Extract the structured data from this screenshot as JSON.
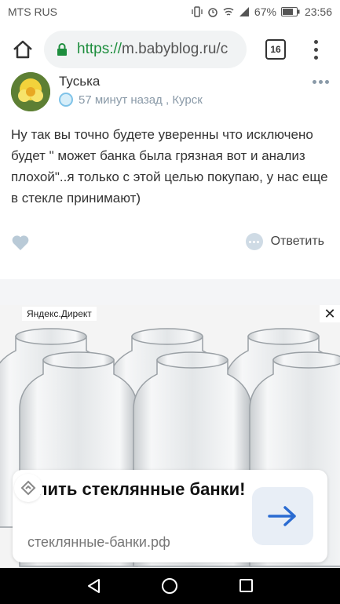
{
  "status_bar": {
    "carrier": "MTS RUS",
    "battery": "67%",
    "time": "23:56"
  },
  "browser": {
    "url_scheme": "https://",
    "url_rest": "m.babyblog.ru/c",
    "tab_count": "16"
  },
  "post": {
    "author": "Туська",
    "time_ago": "57 минут назад",
    "location_separator": ",",
    "location": "Курск",
    "text": "Ну так вы точно будете уверенны что исключено будет \" может банка была грязная вот и анализ плохой\"..я только с этой целью покупаю, у нас еще в стекле принимают)",
    "reply_label": "Ответить"
  },
  "ad": {
    "label": "Яндекс.Директ",
    "close": "✕",
    "title": "упить стеклянные банки!",
    "domain": "стеклянные-банки.рф"
  }
}
